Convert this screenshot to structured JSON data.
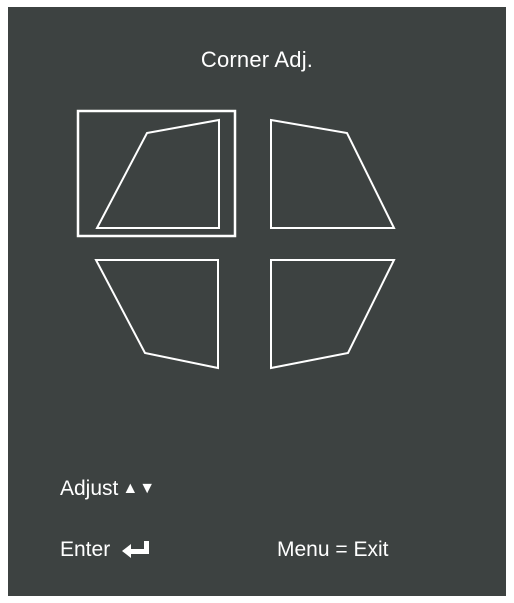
{
  "menu": {
    "title": "Corner Adj.",
    "selected_corner": "top-left",
    "corners": [
      {
        "label": "top-left",
        "selected": true
      },
      {
        "label": "top-right",
        "selected": false
      },
      {
        "label": "bottom-left",
        "selected": false
      },
      {
        "label": "bottom-right",
        "selected": false
      }
    ]
  },
  "footer": {
    "adjust_label": "Adjust",
    "adjust_icons": [
      "triangle-up-icon",
      "triangle-down-icon"
    ],
    "enter_label": "Enter",
    "enter_icon": "enter-return-icon",
    "exit_label": "Menu = Exit"
  },
  "colors": {
    "background": "#3d4241",
    "foreground": "#ffffff"
  }
}
